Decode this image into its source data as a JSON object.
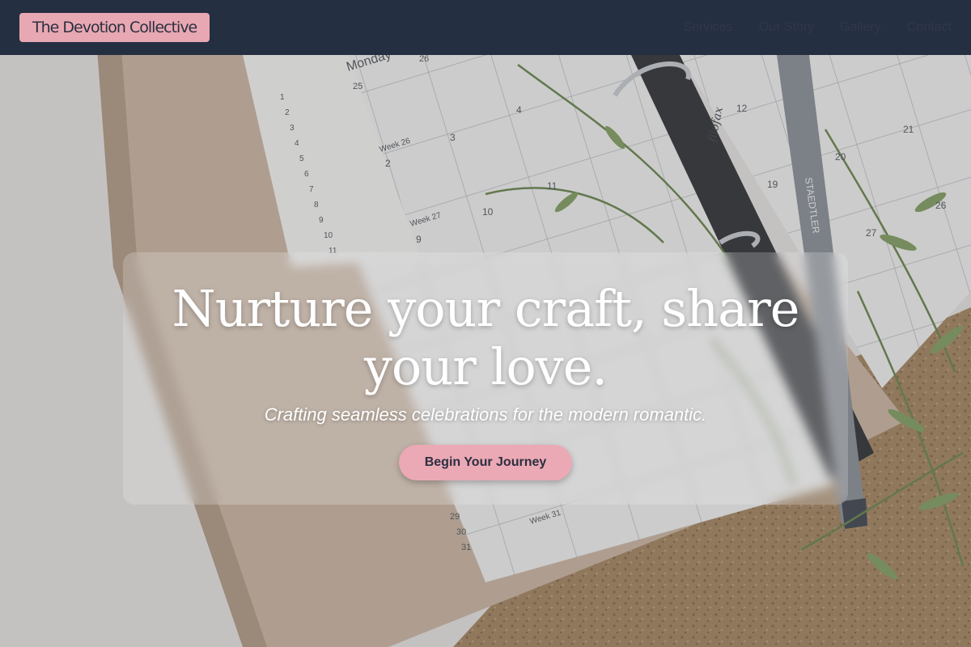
{
  "brand": {
    "name": "The Devotion Collective"
  },
  "nav": {
    "items": [
      {
        "label": "Services"
      },
      {
        "label": "Our Story"
      },
      {
        "label": "Gallery"
      },
      {
        "label": "Contact"
      }
    ]
  },
  "hero": {
    "headline": "Nurture your craft, share your love.",
    "subheadline": "Crafting seamless celebrations for the modern romantic.",
    "cta_label": "Begin Your Journey",
    "planner": {
      "day_header": "Monday",
      "week_labels": [
        "Week 26",
        "Week 27",
        "Week 31"
      ],
      "numbers_left": [
        "1",
        "2",
        "3",
        "4",
        "5",
        "6",
        "7",
        "8",
        "9",
        "10",
        "11"
      ],
      "dates": [
        "25",
        "26",
        "2",
        "3",
        "4",
        "9",
        "10",
        "11",
        "12",
        "19",
        "20",
        "21",
        "26",
        "27",
        "29",
        "30",
        "31"
      ],
      "pen_brand": "STAEDTLER",
      "planner_brand": "filofax"
    }
  },
  "colors": {
    "nav_bg": "#252f42",
    "accent_pink": "#eba9b5",
    "text_dark": "#2a2f3f"
  }
}
